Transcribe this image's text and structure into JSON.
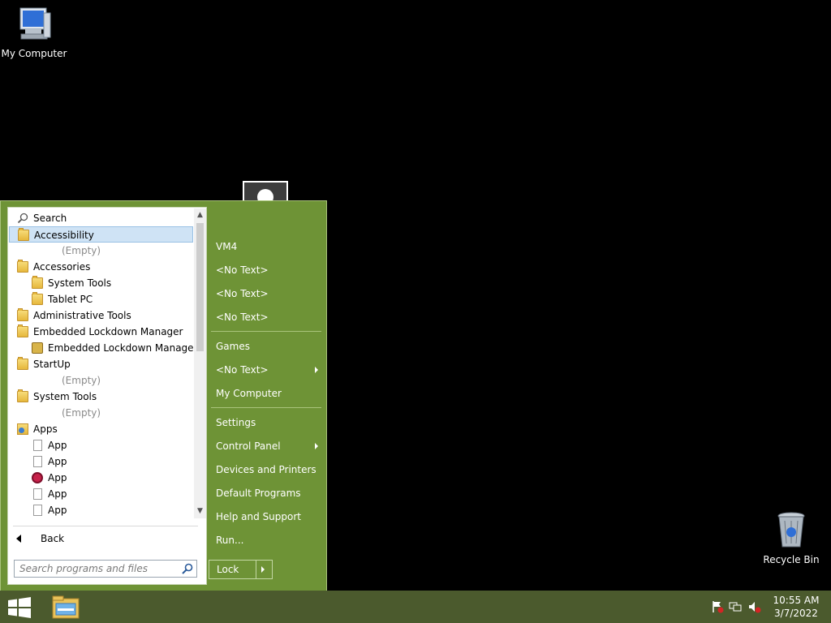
{
  "desktop": {
    "my_computer": "My Computer",
    "recycle_bin": "Recycle Bin"
  },
  "start_menu": {
    "programs": [
      {
        "label": "Search",
        "icon": "search-icon",
        "indent": 0,
        "gray": false,
        "selected": false
      },
      {
        "label": "Accessibility",
        "icon": "folder-icon",
        "indent": 0,
        "gray": false,
        "selected": true
      },
      {
        "label": "(Empty)",
        "icon": "",
        "indent": 1,
        "gray": true,
        "selected": false
      },
      {
        "label": "Accessories",
        "icon": "folder-icon",
        "indent": 0,
        "gray": false,
        "selected": false
      },
      {
        "label": "System Tools",
        "icon": "folder-icon",
        "indent": 1,
        "gray": false,
        "selected": false
      },
      {
        "label": "Tablet PC",
        "icon": "folder-icon",
        "indent": 1,
        "gray": false,
        "selected": false
      },
      {
        "label": "Administrative Tools",
        "icon": "folder-icon",
        "indent": 0,
        "gray": false,
        "selected": false
      },
      {
        "label": "Embedded Lockdown Manager",
        "icon": "folder-icon",
        "indent": 0,
        "gray": false,
        "selected": false
      },
      {
        "label": "Embedded Lockdown Manager",
        "icon": "lock-icon",
        "indent": 1,
        "gray": false,
        "selected": false
      },
      {
        "label": "StartUp",
        "icon": "folder-icon",
        "indent": 0,
        "gray": false,
        "selected": false
      },
      {
        "label": "(Empty)",
        "icon": "",
        "indent": 1,
        "gray": true,
        "selected": false
      },
      {
        "label": "System Tools",
        "icon": "folder-icon",
        "indent": 0,
        "gray": false,
        "selected": false
      },
      {
        "label": "(Empty)",
        "icon": "",
        "indent": 1,
        "gray": true,
        "selected": false
      },
      {
        "label": "Apps",
        "icon": "apps-folder-icon",
        "indent": 0,
        "gray": false,
        "selected": false
      },
      {
        "label": "App",
        "icon": "document-icon",
        "indent": 1,
        "gray": false,
        "selected": false
      },
      {
        "label": "App",
        "icon": "document-icon",
        "indent": 1,
        "gray": false,
        "selected": false
      },
      {
        "label": "App",
        "icon": "alarm-clock-icon",
        "indent": 1,
        "gray": false,
        "selected": false
      },
      {
        "label": "App",
        "icon": "document-icon",
        "indent": 1,
        "gray": false,
        "selected": false
      },
      {
        "label": "App",
        "icon": "document-icon",
        "indent": 1,
        "gray": false,
        "selected": false
      }
    ],
    "back_label": "Back",
    "search_placeholder": "Search programs and files",
    "right_items": [
      {
        "label": "VM4",
        "arrow": false
      },
      {
        "label": "<No Text>",
        "arrow": false
      },
      {
        "label": "<No Text>",
        "arrow": false
      },
      {
        "label": "<No Text>",
        "arrow": false
      },
      {
        "label": "Games",
        "arrow": false
      },
      {
        "label": "<No Text>",
        "arrow": true
      },
      {
        "label": "My Computer",
        "arrow": false
      },
      {
        "label": "Settings",
        "arrow": false
      },
      {
        "label": "Control Panel",
        "arrow": true
      },
      {
        "label": "Devices and Printers",
        "arrow": false
      },
      {
        "label": "Default Programs",
        "arrow": false
      },
      {
        "label": "Help and Support",
        "arrow": false
      },
      {
        "label": "Run...",
        "arrow": false
      }
    ],
    "lock_label": "Lock"
  },
  "taskbar": {
    "time": "10:55 AM",
    "date": "3/7/2022"
  },
  "colors": {
    "menu_bg": "#6e9336",
    "taskbar_bg": "#4b5a2d",
    "selection": "#cfe3f5"
  }
}
